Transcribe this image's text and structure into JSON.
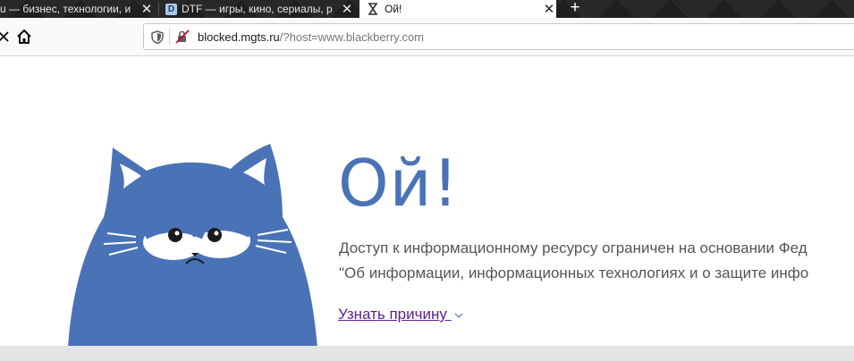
{
  "browser": {
    "tabs": [
      {
        "title": "u — бизнес, технологии, и",
        "active": false,
        "favicon": "none"
      },
      {
        "title": "DTF — игры, кино, сериалы, р",
        "active": false,
        "favicon": "dtf-logo",
        "favicon_letter": "D"
      },
      {
        "title": "Ой!",
        "active": true,
        "favicon": "hourglass-icon"
      }
    ],
    "close_glyph": "✕",
    "new_tab_glyph": "+",
    "url": {
      "domain": "blocked.mgts.ru",
      "path": "/?host=www.blackberry.com"
    }
  },
  "page": {
    "heading": "Ой!",
    "message_line1": "Доступ к информационному ресурсу ограничен на основании Фед",
    "message_line2": "\"Об информации, информационных технологиях и о защите инфо",
    "learn_more": "Узнать причину",
    "accent_color": "#4a73b7",
    "link_color": "#5a1f8e"
  }
}
